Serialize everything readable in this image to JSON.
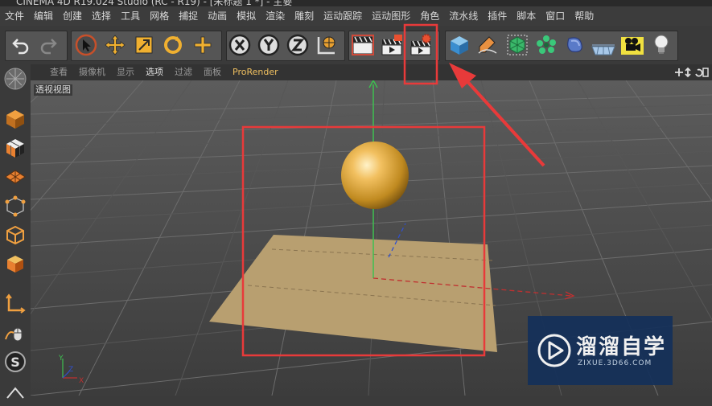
{
  "app": {
    "title": "CINEMA 4D R19.024 Studio (RC - R19) - [未标题 1 *] - 主要"
  },
  "menu": [
    "文件",
    "编辑",
    "创建",
    "选择",
    "工具",
    "网格",
    "捕捉",
    "动画",
    "模拟",
    "渲染",
    "雕刻",
    "运动跟踪",
    "运动图形",
    "角色",
    "流水线",
    "插件",
    "脚本",
    "窗口",
    "帮助"
  ],
  "viewport_menu": {
    "items": [
      "查看",
      "摄像机",
      "显示",
      "选项",
      "过滤",
      "面板"
    ],
    "render": "ProRender"
  },
  "viewport": {
    "label": "透视视图"
  },
  "watermark": {
    "title": "溜溜自学",
    "url": "ZIXUE.3D66.COM"
  },
  "icons": {
    "toolbar": [
      "undo-icon",
      "redo-icon",
      "select-icon",
      "move-icon",
      "scale-icon",
      "rotate-icon",
      "add-icon",
      "x-axis-icon",
      "y-axis-icon",
      "z-axis-icon",
      "world-coordinates-icon",
      "render-view-icon",
      "render-picture-viewer-icon",
      "render-settings-icon",
      "cube-icon",
      "pen-icon",
      "subdivision-icon",
      "cloner-icon",
      "deformer-icon",
      "floor-icon",
      "camera-icon",
      "light-icon"
    ],
    "left": [
      "model-mode-icon",
      "texture-mode-icon",
      "workplane-icon",
      "points-mode-icon",
      "edges-mode-icon",
      "polygons-mode-icon",
      "axis-icon",
      "tweak-icon",
      "snap-icon"
    ]
  },
  "colors": {
    "highlight": "#e83a3a",
    "accent": "#f0c060"
  }
}
